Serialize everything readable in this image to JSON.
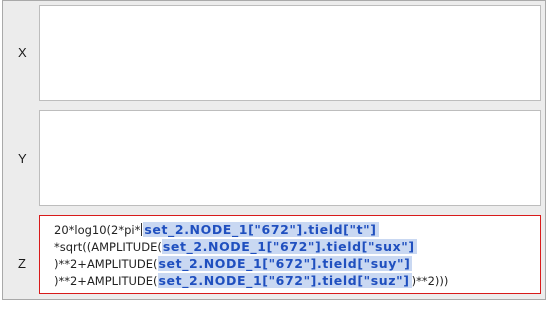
{
  "rows": {
    "x": {
      "label": "X",
      "value": ""
    },
    "y": {
      "label": "Y",
      "value": ""
    },
    "z": {
      "label": "Z"
    }
  },
  "expression": {
    "line1": {
      "prefix": "20*log10(2*pi*",
      "token": "set_2.NODE_1[\"672\"].tield[\"t\"]",
      "suffix": ""
    },
    "line2": {
      "prefix": "*sqrt((AMPLITUDE(",
      "token": "set_2.NODE_1[\"672\"].tield[\"sux\"]",
      "suffix": ""
    },
    "line3": {
      "prefix": ")**2+AMPLITUDE(",
      "token": "set_2.NODE_1[\"672\"].tield[\"suy\"]",
      "suffix": ""
    },
    "line4": {
      "prefix": ")**2+AMPLITUDE(",
      "token": "set_2.NODE_1[\"672\"].tield[\"suz\"]",
      "suffix": ")**2)))"
    }
  },
  "colors": {
    "active_border": "#d81b1b",
    "token_highlight": "#c9d8f2",
    "token_text": "#1f4fbf"
  }
}
